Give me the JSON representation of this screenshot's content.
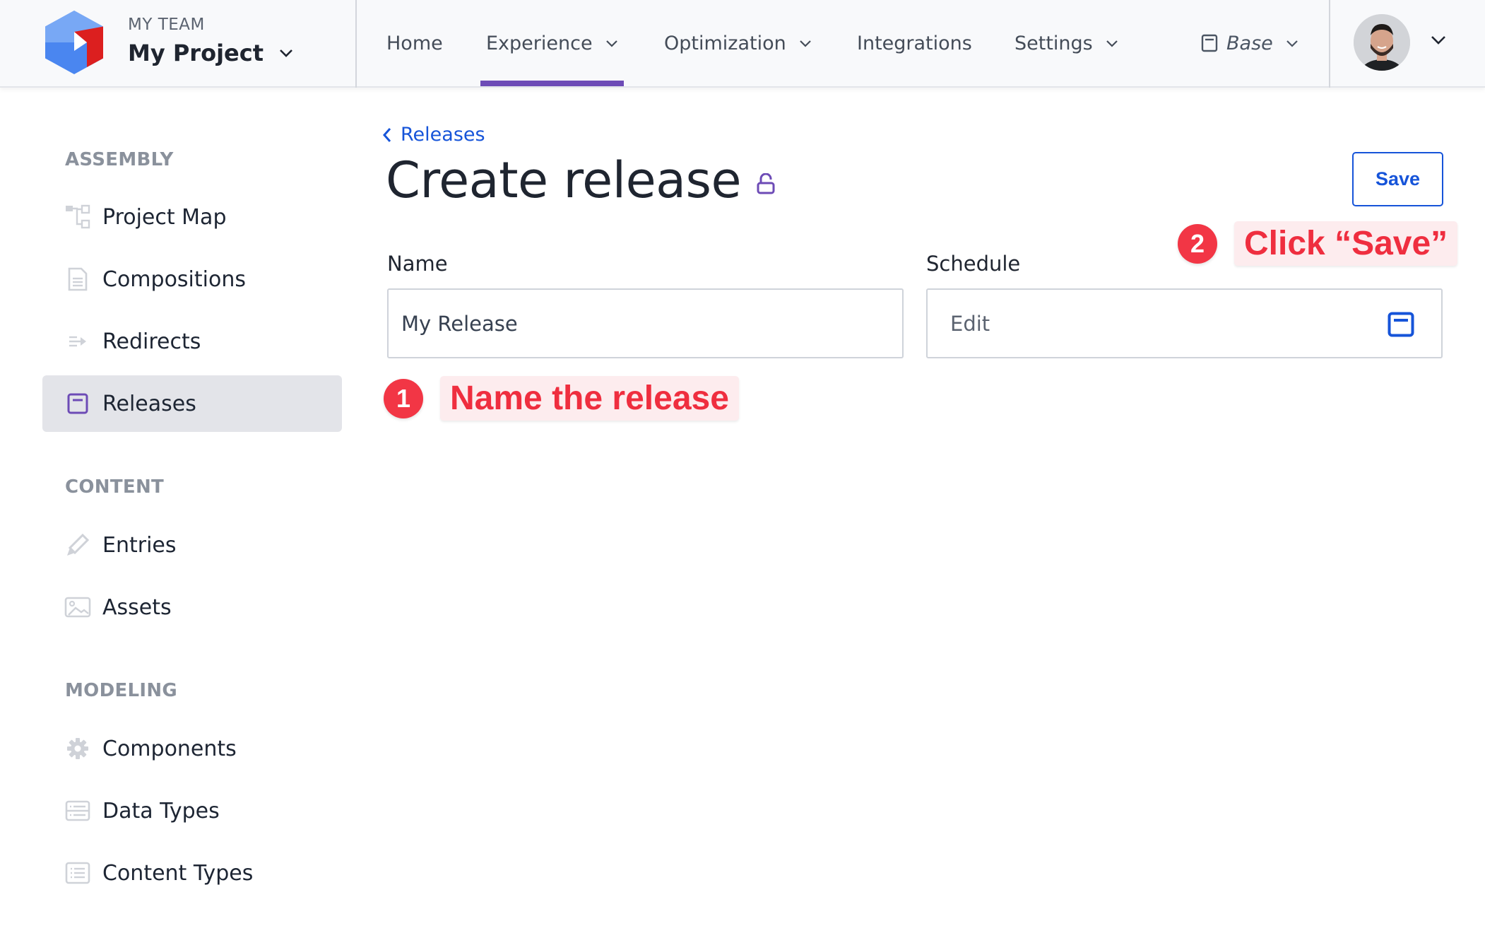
{
  "header": {
    "team_label": "MY TEAM",
    "project_name": "My Project",
    "nav": [
      {
        "label": "Home",
        "has_dropdown": false,
        "active": false
      },
      {
        "label": "Experience",
        "has_dropdown": true,
        "active": true
      },
      {
        "label": "Optimization",
        "has_dropdown": true,
        "active": false
      },
      {
        "label": "Integrations",
        "has_dropdown": false,
        "active": false
      },
      {
        "label": "Settings",
        "has_dropdown": true,
        "active": false
      }
    ],
    "release_selector": {
      "label": "Base",
      "icon": "calendar-icon"
    },
    "user": {
      "avatar": "user-avatar",
      "menu_icon": "chevron-down-icon"
    }
  },
  "sidebar": {
    "sections": [
      {
        "title": "ASSEMBLY",
        "items": [
          {
            "label": "Project Map",
            "icon": "sitemap-icon",
            "active": false
          },
          {
            "label": "Compositions",
            "icon": "document-icon",
            "active": false
          },
          {
            "label": "Redirects",
            "icon": "redirect-arrow-icon",
            "active": false
          },
          {
            "label": "Releases",
            "icon": "calendar-icon",
            "active": true
          }
        ]
      },
      {
        "title": "CONTENT",
        "items": [
          {
            "label": "Entries",
            "icon": "pencil-icon",
            "active": false
          },
          {
            "label": "Assets",
            "icon": "image-icon",
            "active": false
          }
        ]
      },
      {
        "title": "MODELING",
        "items": [
          {
            "label": "Components",
            "icon": "gear-icon",
            "active": false
          },
          {
            "label": "Data Types",
            "icon": "database-list-icon",
            "active": false
          },
          {
            "label": "Content Types",
            "icon": "list-icon",
            "active": false
          }
        ]
      }
    ]
  },
  "main": {
    "breadcrumb_back": "Releases",
    "title": "Create release",
    "title_icon": "unlock-icon",
    "save_label": "Save",
    "fields": {
      "name": {
        "label": "Name",
        "value": "My Release"
      },
      "schedule": {
        "label": "Schedule",
        "value": "Edit",
        "icon": "calendar-icon"
      }
    }
  },
  "annotations": [
    {
      "number": "1",
      "text": "Name the release"
    },
    {
      "number": "2",
      "text": "Click “Save”"
    }
  ],
  "colors": {
    "accent_purple": "#6d4bb6",
    "link_blue": "#1654d9",
    "annotation_red": "#f23645",
    "annotation_bg": "#fdecee"
  }
}
